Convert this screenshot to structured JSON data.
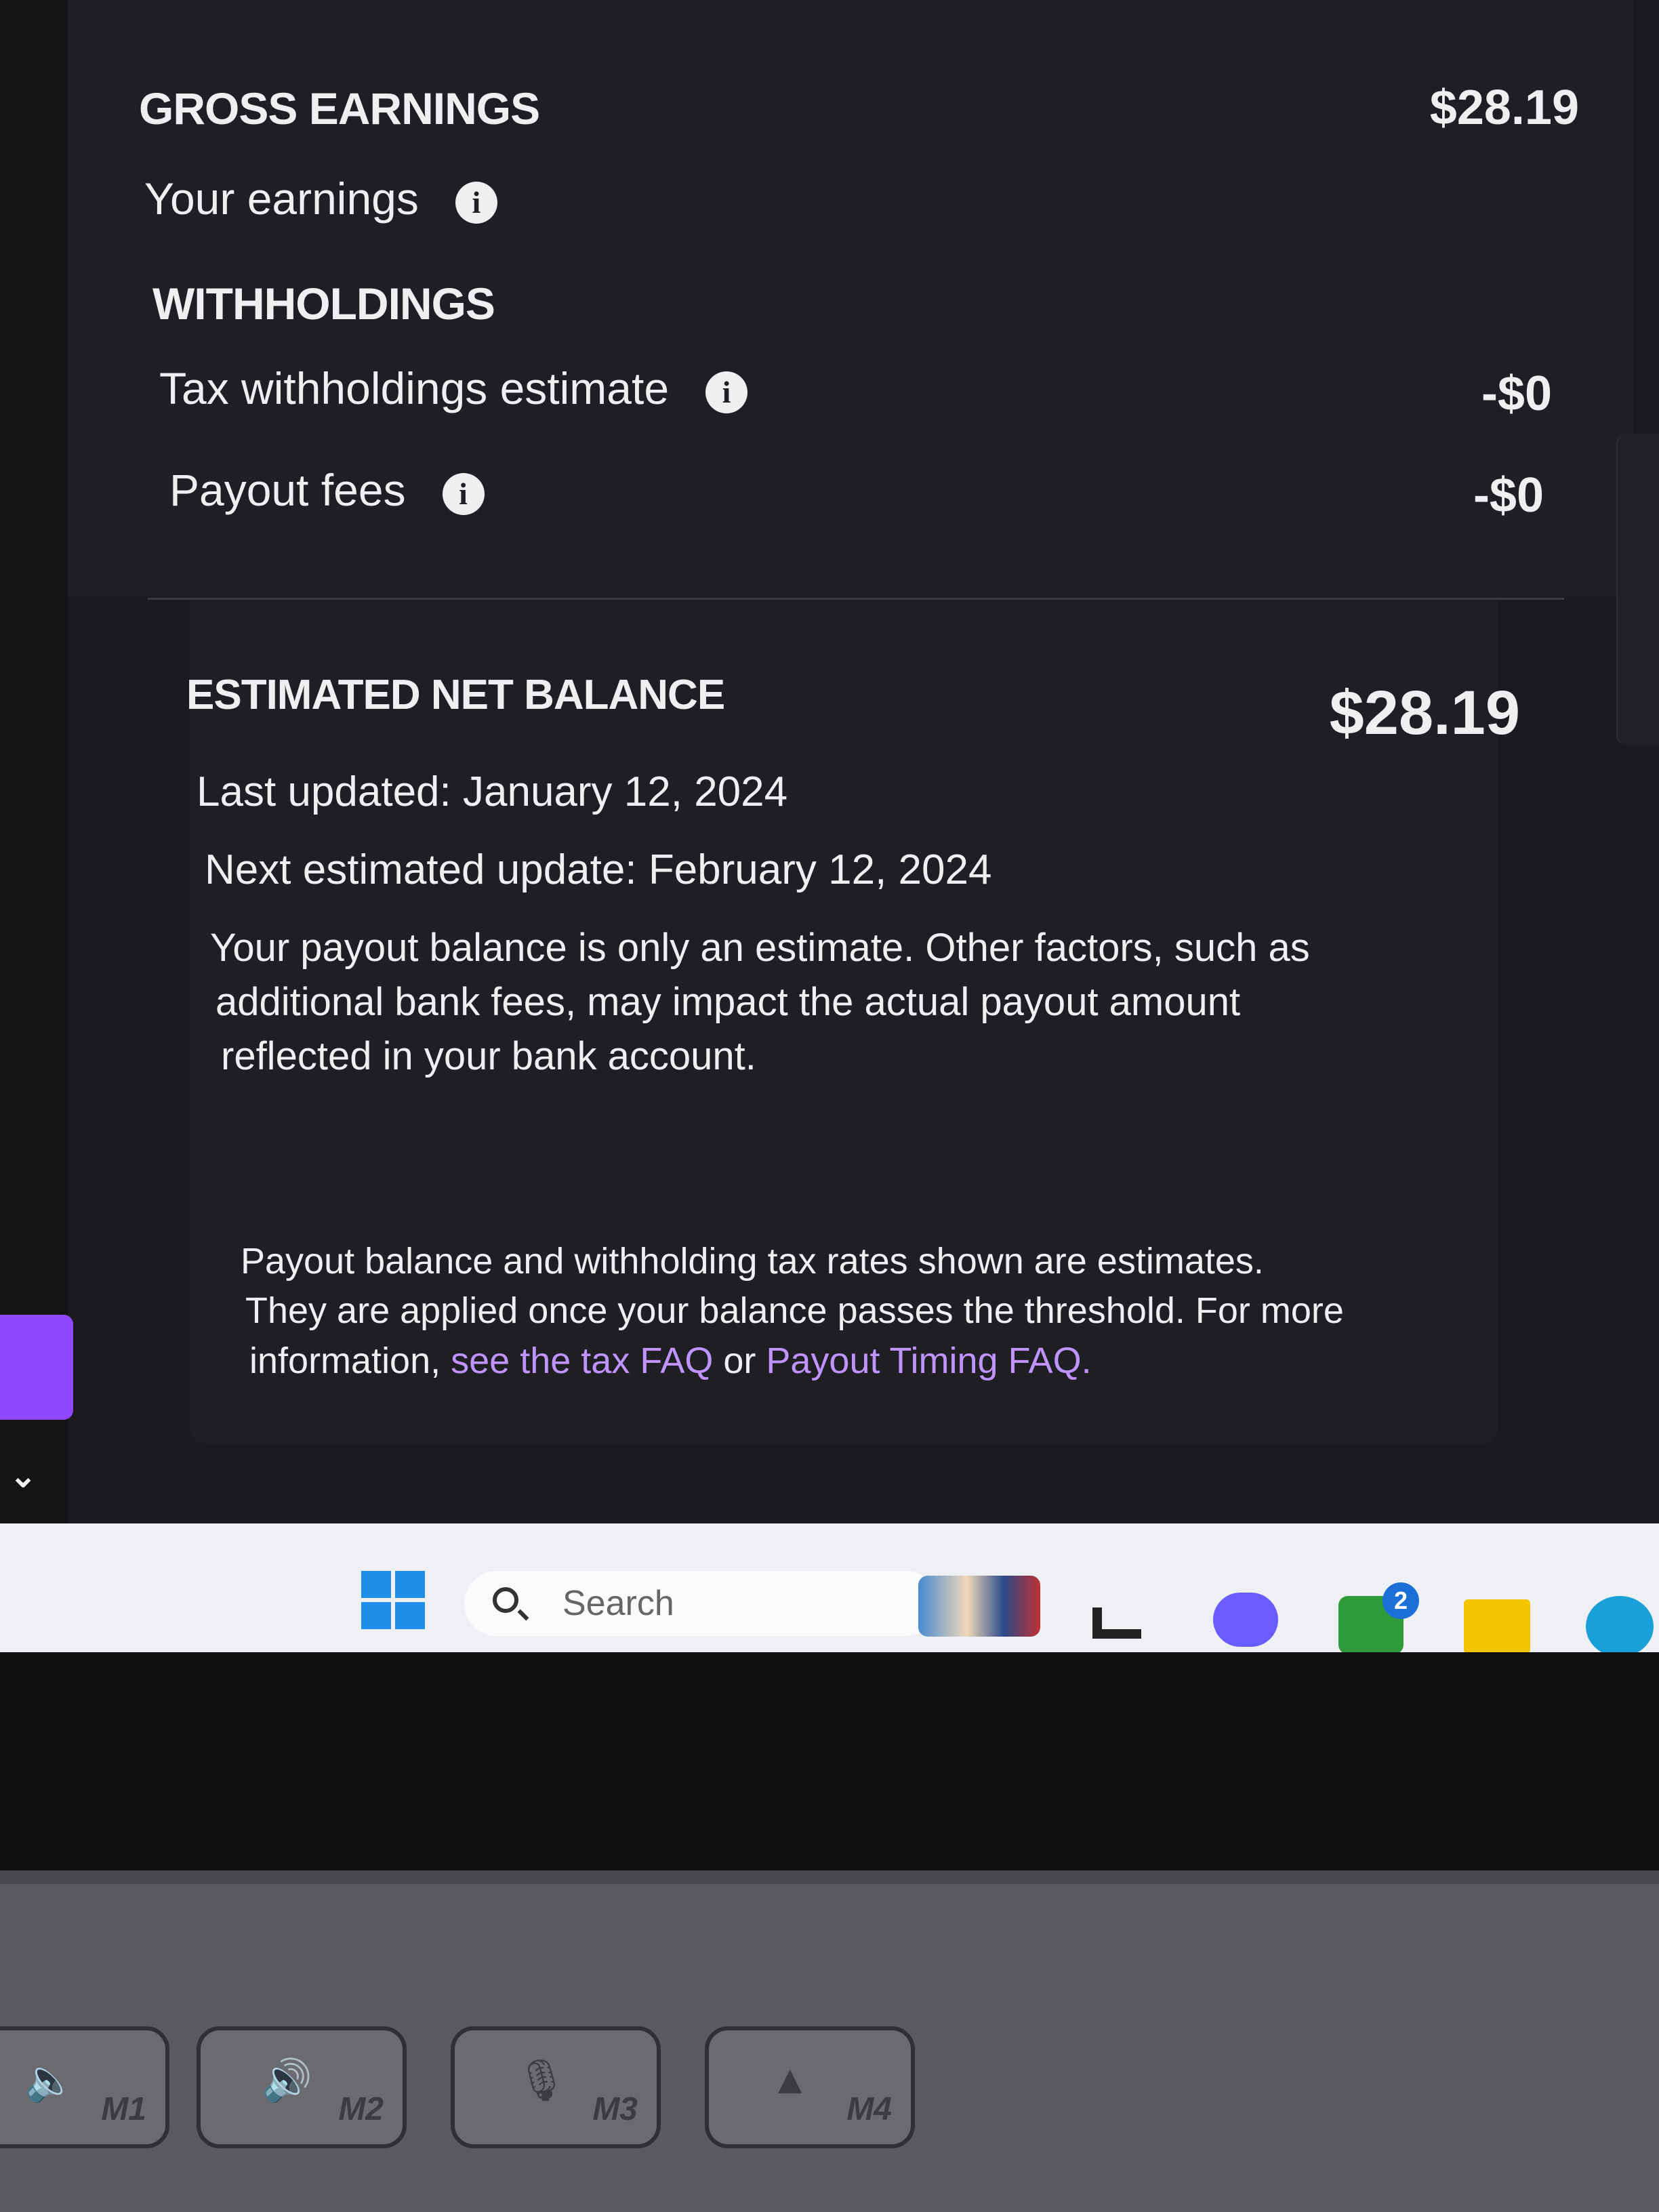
{
  "gross": {
    "heading": "GROSS EARNINGS",
    "amount": "$28.19",
    "your_earnings_label": "Your earnings"
  },
  "withholdings": {
    "heading": "WITHHOLDINGS",
    "tax_label": "Tax withholdings estimate",
    "tax_amount": "-$0",
    "fees_label": "Payout fees",
    "fees_amount": "-$0"
  },
  "net": {
    "heading": "ESTIMATED NET BALANCE",
    "amount": "$28.19",
    "last_updated": "Last updated: January 12, 2024",
    "next_update": "Next estimated update: February 12, 2024",
    "disclaimer_line1": "Your payout balance is only an estimate. Other factors, such as",
    "disclaimer_line2": "additional bank fees, may impact the actual payout amount",
    "disclaimer_line3": "reflected in your bank account."
  },
  "footnote": {
    "line1": "Payout balance and withholding tax rates shown are estimates.",
    "line2": "They are applied once your balance passes the threshold. For more",
    "line3_prefix": "information, ",
    "tax_faq_link": "see the tax FAQ",
    "or": " or ",
    "timing_faq_link": "Payout Timing FAQ."
  },
  "taskbar": {
    "search_placeholder": "Search",
    "xbox_badge": "2"
  },
  "keyboard": {
    "keys": [
      "M1",
      "M2",
      "M3",
      "M4"
    ]
  },
  "colors": {
    "background": "#1f1f23",
    "link": "#bf94ff",
    "accent_purple": "#9147ff"
  },
  "icons": [
    "info-icon",
    "windows-icon",
    "search-icon",
    "chevron-down-icon",
    "teams-icon",
    "xbox-icon",
    "folder-icon",
    "edge-icon"
  ]
}
